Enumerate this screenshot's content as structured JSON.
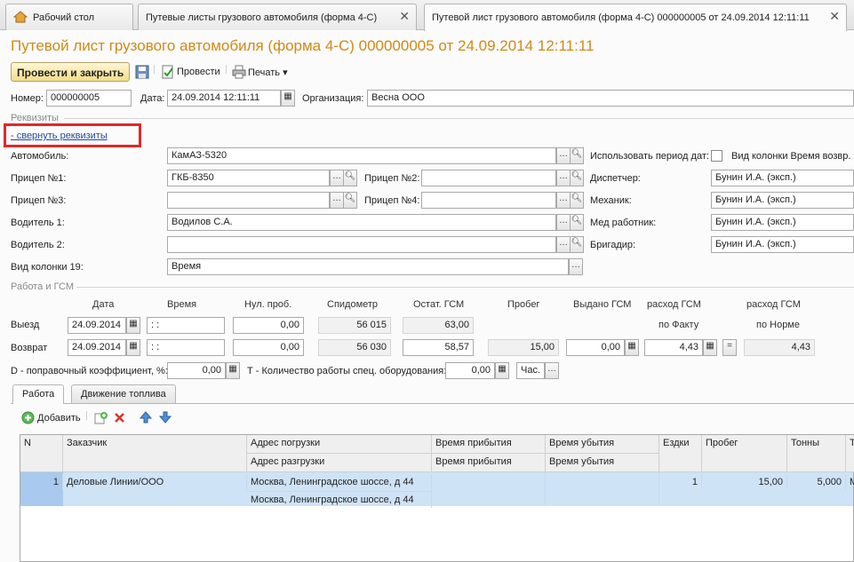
{
  "tabs": [
    {
      "label": "Рабочий стол"
    },
    {
      "label": "Путевые листы грузового автомобиля (форма 4-С)"
    },
    {
      "label": "Путевой лист грузового автомобиля (форма 4-С) 000000005 от 24.09.2014 12:11:11"
    }
  ],
  "title": "Путевой лист грузового автомобиля (форма 4-С) 000000005 от 24.09.2014 12:11:11",
  "toolbar": {
    "post_close": "Провести и закрыть",
    "post": "Провести",
    "print": "Печать"
  },
  "header": {
    "number_label": "Номер:",
    "number": "000000005",
    "date_label": "Дата:",
    "date": "24.09.2014 12:11:11",
    "org_label": "Организация:",
    "org": "Весна ООО"
  },
  "requisites": {
    "section": "Реквизиты",
    "collapse_link": "- свернуть реквизиты",
    "car_label": "Автомобиль:",
    "car": "КамАЗ-5320",
    "trailer1_label": "Прицеп №1:",
    "trailer1": "ГКБ-8350",
    "trailer2_label": "Прицеп №2:",
    "trailer2": "",
    "trailer3_label": "Прицеп №3:",
    "trailer3": "",
    "trailer4_label": "Прицеп №4:",
    "trailer4": "",
    "driver1_label": "Водитель 1:",
    "driver1": "Водилов С.А.",
    "driver2_label": "Водитель 2:",
    "driver2": "",
    "col19_label": "Вид колонки 19:",
    "col19": "Время",
    "use_period_label": "Использовать период дат:",
    "col_time_label": "Вид колонки Время возвр.",
    "dispatcher_label": "Диспетчер:",
    "dispatcher": "Бунин И.А. (эксп.)",
    "mechanic_label": "Механик:",
    "mechanic": "Бунин И.А. (эксп.)",
    "medic_label": "Мед работник:",
    "medic": "Бунин И.А. (эксп.)",
    "foreman_label": "Бригадир:",
    "foreman": "Бунин И.А. (эксп.)"
  },
  "gsm": {
    "section": "Работа и ГСМ",
    "columns": {
      "date": "Дата",
      "time": "Время",
      "zero": "Нул. проб.",
      "speedo": "Спидометр",
      "rest": "Остат. ГСМ",
      "run": "Пробег",
      "issued": "Выдано ГСМ",
      "fact1": "расход ГСМ",
      "fact2": "по Факту",
      "norm1": "расход ГСМ",
      "norm2": "по Норме"
    },
    "out_label": "Выезд",
    "out": {
      "date": "24.09.2014",
      "time": " :  :",
      "zero": "0,00",
      "speedo": "56 015",
      "rest": "63,00"
    },
    "ret_label": "Возврат",
    "ret": {
      "date": "24.09.2014",
      "time": " :  :",
      "zero": "0,00",
      "speedo": "56 030",
      "rest": "58,57",
      "run": "15,00",
      "issued": "0,00",
      "fact": "4,43",
      "eq": "=",
      "norm": "4,43"
    },
    "d_label": "D - поправочный коэффициент, %:",
    "d_value": "0,00",
    "t_label": "Т - Количество работы спец. оборудования:",
    "t_value": "0,00",
    "t_unit": "Час."
  },
  "subtabs": [
    {
      "label": "Работа"
    },
    {
      "label": "Движение топлива"
    }
  ],
  "table_toolbar": {
    "add": "Добавить"
  },
  "table": {
    "headers": {
      "n": "N",
      "customer": "Заказчик",
      "load": "Адрес погрузки",
      "unload": "Адрес разгрузки",
      "arr1": "Время прибытия",
      "dep1": "Время убытия",
      "arr2": "Время прибытия",
      "dep2": "Время убытия",
      "trips": "Ездки",
      "run": "Пробег",
      "tons": "Тонны",
      "more": "Т"
    },
    "rows": [
      {
        "n": "1",
        "customer": "Деловые Линии/ООО",
        "load": "Москва, Ленинградское шоссе, д 44",
        "unload": "Москва, Ленинградское шоссе, д 44",
        "trips": "1",
        "run": "15,00",
        "tons": "5,000",
        "more": "M"
      }
    ]
  },
  "colors": {
    "accent": "#d08a17",
    "red_box": "#e0282a",
    "selected_row": "#cfe3f7",
    "link": "#1f4b9f"
  }
}
